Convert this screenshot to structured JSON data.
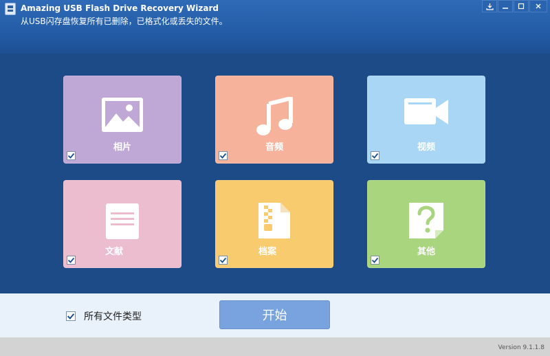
{
  "window": {
    "title": "Amazing USB Flash Drive Recovery Wizard",
    "subtitle": "从USB闪存盘恢复所有已删除，已格式化或丢失的文件。",
    "controls": [
      "download-icon",
      "minimize-icon",
      "maximize-icon",
      "close-icon"
    ]
  },
  "tiles": [
    {
      "label": "相片",
      "icon": "image-icon",
      "color": "#c0a8d6",
      "checked": true
    },
    {
      "label": "音频",
      "icon": "music-icon",
      "color": "#f6b29b",
      "checked": true
    },
    {
      "label": "视频",
      "icon": "video-camera-icon",
      "color": "#a9d6f4",
      "checked": true
    },
    {
      "label": "文献",
      "icon": "document-icon",
      "color": "#ecbccf",
      "checked": true
    },
    {
      "label": "档案",
      "icon": "archive-zip-icon",
      "color": "#f8cb6e",
      "checked": true
    },
    {
      "label": "其他",
      "icon": "question-file-icon",
      "color": "#a8d57d",
      "checked": true
    }
  ],
  "bottom": {
    "all_types_label": "所有文件类型",
    "all_types_checked": true,
    "start_label": "开始"
  },
  "status": {
    "version": "Version 9.1.1.8"
  }
}
